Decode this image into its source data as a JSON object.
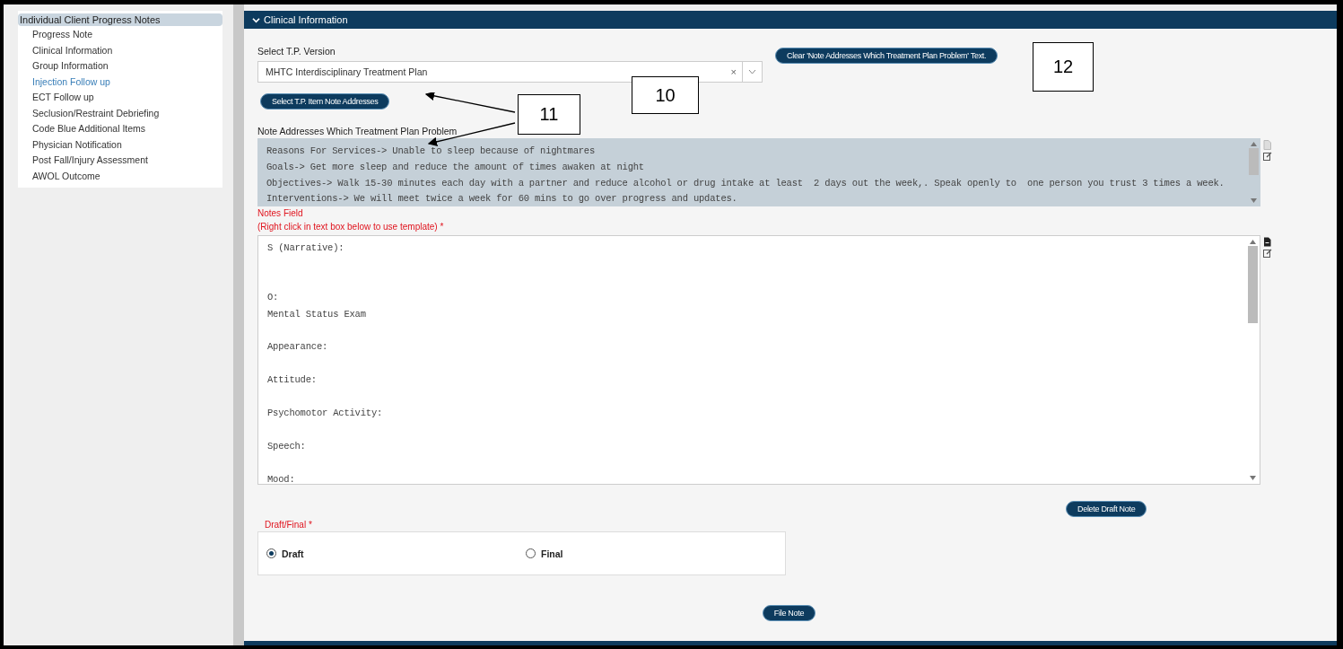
{
  "sidebar": {
    "title": "Individual Client Progress Notes",
    "items": [
      {
        "label": "Progress Note",
        "selected": false
      },
      {
        "label": "Clinical Information",
        "selected": false
      },
      {
        "label": "Group Information",
        "selected": false
      },
      {
        "label": "Injection Follow up",
        "selected": true
      },
      {
        "label": "ECT Follow up",
        "selected": false
      },
      {
        "label": "Seclusion/Restraint Debriefing",
        "selected": false
      },
      {
        "label": "Code Blue Additional Items",
        "selected": false
      },
      {
        "label": "Physician Notification",
        "selected": false
      },
      {
        "label": "Post Fall/Injury Assessment",
        "selected": false
      },
      {
        "label": "AWOL Outcome",
        "selected": false
      }
    ]
  },
  "section": {
    "title": "Clinical Information",
    "expanded": true
  },
  "tp_version": {
    "label": "Select T.P. Version",
    "value": "MHTC Interdisciplinary Treatment Plan",
    "clear": "×"
  },
  "clear_button": "Clear 'Note Addresses Which Treatment Plan Problem' Text.",
  "select_items_button": "Select T.P. Item Note Addresses",
  "note_addresses": {
    "label": "Note Addresses Which Treatment Plan Problem",
    "lines": [
      "Reasons For Services-> Unable to sleep because of nightmares",
      "Goals-> Get more sleep and reduce the amount of times awaken at night",
      "Objectives-> Walk 15-30 minutes each day with a partner and reduce alcohol or drug intake at least  2 days out the week,. Speak openly to  one person you trust 3 times a week.",
      "Interventions-> We will meet twice a week for 60 mins to go over progress and updates."
    ]
  },
  "notes_field": {
    "label": "Notes Field",
    "hint": "(Right click in text box below to use template)",
    "required": "*",
    "value": "S (Narrative):\n\n\nO:\nMental Status Exam\n\nAppearance:\n\nAttitude:\n\nPsychomotor Activity:\n\nSpeech:\n\nMood:"
  },
  "draft_final": {
    "label": "Draft/Final",
    "required": "*",
    "options": [
      {
        "label": "Draft",
        "selected": true
      },
      {
        "label": "Final",
        "selected": false
      }
    ]
  },
  "delete_button": "Delete Draft Note",
  "file_button": "File Note",
  "callouts": [
    {
      "label": "10"
    },
    {
      "label": "11"
    },
    {
      "label": "12"
    }
  ]
}
